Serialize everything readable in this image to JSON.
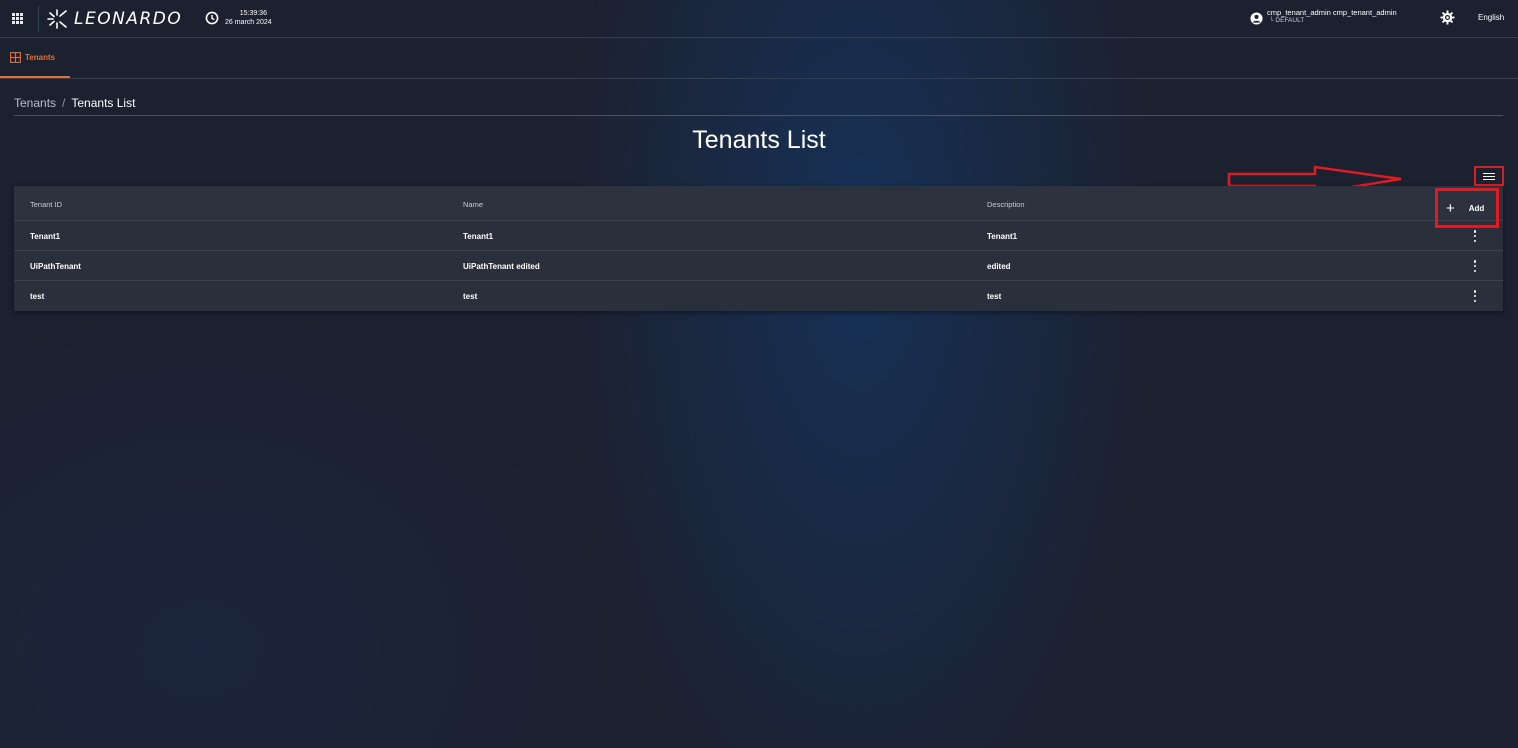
{
  "app": {
    "logo_text": "LEONARDO",
    "time": "15:39:36",
    "date": "26 march 2024",
    "user": "cmp_tenant_admin cmp_tenant_admin",
    "tenant": "└ DEFAULT",
    "language": "English"
  },
  "tabs": [
    {
      "label": "Tenants",
      "active": true
    }
  ],
  "breadcrumb": {
    "parent": "Tenants",
    "separator": "/",
    "current": "Tenants List"
  },
  "page": {
    "title": "Tenants List",
    "add_label": "Add"
  },
  "table": {
    "columns": [
      "Tenant ID",
      "Name",
      "Description"
    ],
    "rows": [
      [
        "Tenant1",
        "Tenant1",
        "Tenant1"
      ],
      [
        "UiPathTenant",
        "UiPathTenant edited",
        "edited"
      ],
      [
        "test",
        "test",
        "test"
      ]
    ]
  },
  "colors": {
    "accent": "#e0703a",
    "highlight": "#e01b24",
    "background": "#1c2130"
  },
  "icons": [
    "apps-grid-icon",
    "leonardo-logo-icon",
    "clock-icon",
    "user-icon",
    "gear-icon",
    "tenants-tab-icon",
    "hamburger-menu-icon",
    "plus-icon",
    "kebab-menu-icon",
    "annotation-arrow"
  ]
}
